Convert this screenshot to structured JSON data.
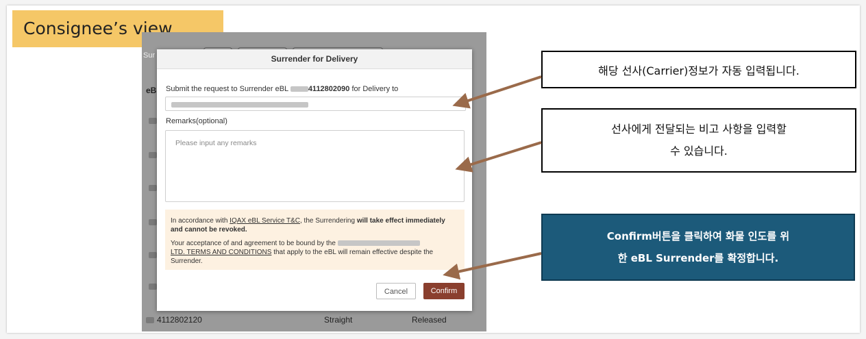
{
  "title": "Consignee’s view",
  "background_screen": {
    "header_fragment": "Sur",
    "left_fragment": "eB",
    "bottom_row": {
      "id": "4112802120",
      "type": "Straight",
      "status": "Released"
    }
  },
  "modal": {
    "title": "Surrender for Delivery",
    "request_prefix": "Submit the request to Surrender eBL ",
    "ebl_number": "4112802090",
    "request_suffix": " for Delivery to",
    "remarks_label": "Remarks(optional)",
    "remarks_placeholder": "Please input any remarks",
    "notice_1_a": "In accordance with ",
    "notice_1_link": "IQAX eBL Service T&C",
    "notice_1_b": ", the Surrendering ",
    "notice_1_bold": "will take effect immediately and cannot be revoked.",
    "notice_2_a": "Your acceptance of and agreement to be bound by the ",
    "notice_2_link": "LTD. TERMS AND CONDITIONS",
    "notice_2_b": " that apply to the eBL will remain effective despite the Surrender.",
    "cancel_label": "Cancel",
    "confirm_label": "Confirm"
  },
  "callouts": {
    "carrier": "해당 선사(Carrier)정보가 자동 입력됩니다.",
    "remarks_line1": "선사에게 전달되는 비고 사항을 입력할",
    "remarks_line2": "수 있습니다.",
    "confirm_line1": "Confirm버튼을 클릭하여 화물 인도를 위",
    "confirm_line2": "한 eBL Surrender를 확정합니다."
  },
  "colors": {
    "title_bg": "#f5c767",
    "confirm_button": "#8a3f2e",
    "notice_bg": "#fdf1e1",
    "callout_dark": "#1c5a7a",
    "arrow": "#9a6a4a"
  }
}
